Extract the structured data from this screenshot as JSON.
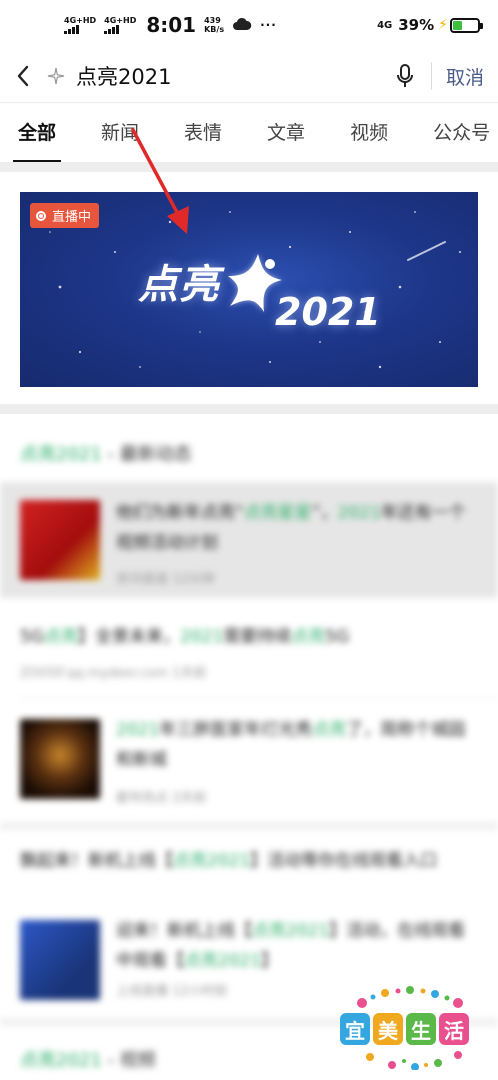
{
  "status_bar": {
    "sim1_label": "4G+HD",
    "sim2_label": "4G+HD",
    "time": "8:01",
    "speed_value": "439",
    "speed_unit": "KB/s",
    "network": "4G",
    "battery_percent_text": "39%",
    "battery_level": 0.39,
    "colors": {
      "battery_fill": "#3fbf3f",
      "charging_bolt": "#f2b400"
    }
  },
  "search": {
    "query": "点亮2021",
    "cancel_label": "取消",
    "icons": [
      "back-icon",
      "spark-icon",
      "microphone-icon"
    ]
  },
  "tabs": [
    {
      "label": "全部",
      "active": true
    },
    {
      "label": "新闻",
      "active": false
    },
    {
      "label": "表情",
      "active": false
    },
    {
      "label": "文章",
      "active": false
    },
    {
      "label": "视频",
      "active": false
    },
    {
      "label": "公众号",
      "active": false
    }
  ],
  "banner": {
    "badge": "直播中",
    "title": "点亮",
    "year": "2021",
    "colors": {
      "badge": "#e8553d",
      "background": "#1d3688"
    }
  },
  "section_latest": {
    "keyword": "点亮2021",
    "suffix": " - 最新动态"
  },
  "results": [
    {
      "title_parts": [
        "他们为新年点亮“",
        "点亮星星",
        "”，",
        "2021",
        "年还有一个视频活动计划"
      ],
      "meta": "资讯报道  12分钟"
    },
    {
      "title_parts": [
        "5G",
        "点亮",
        "】全景未来，",
        "2021",
        "需要持续",
        "点亮",
        "5G"
      ],
      "meta": "ZOO5F.qq.mydexr.com  1天前"
    },
    {
      "title_parts": [
        "2021",
        "年三胖医家年灯光秀",
        "点亮",
        "了，简称个城园和新城"
      ],
      "meta": "都市热点  2天前"
    },
    {
      "title_parts": [
        "飘起来！新机上线【",
        "点亮2021",
        "】活动等你在线观看入口"
      ],
      "meta": ""
    },
    {
      "title_parts": [
        "迎来！新机上线【",
        "点亮2021",
        "】活动，在线观看中观看【",
        "点亮2021",
        "】"
      ],
      "meta": "上线直播  12小时前"
    }
  ],
  "section_video": {
    "keyword": "点亮2021",
    "suffix": " - 视频"
  },
  "watermark": {
    "chars": [
      "宜",
      "美",
      "生",
      "活"
    ],
    "colors": [
      "#35a7e0",
      "#f0a81e",
      "#5bb94a",
      "#e9508d"
    ]
  },
  "annotation": {
    "arrow_color": "#e02a2a"
  }
}
